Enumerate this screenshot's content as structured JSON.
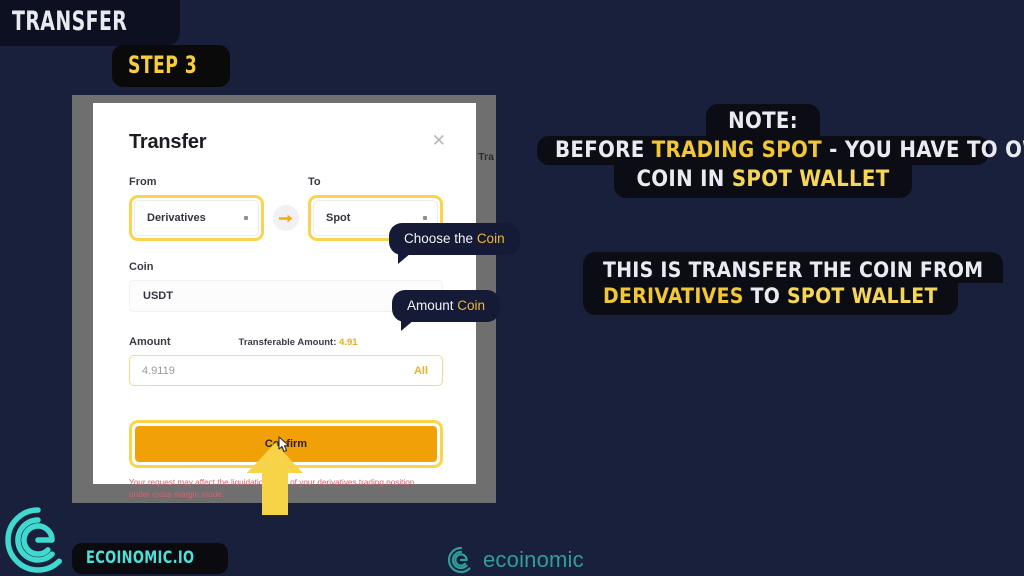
{
  "badges": {
    "transfer": "TRANSFER",
    "step": "STEP 3"
  },
  "app_window": {
    "background_tab_label": "Tra"
  },
  "modal": {
    "title": "Transfer",
    "close_icon": "close-icon",
    "from_label": "From",
    "from_value": "Derivatives",
    "to_label": "To",
    "to_value": "Spot",
    "swap_icon": "arrow-right-icon",
    "coin_label": "Coin",
    "coin_value": "USDT",
    "amount_label": "Amount",
    "transferable_prefix": "Transferable Amount: ",
    "transferable_value": "4.91",
    "amount_value": "4.9119",
    "all_label": "All",
    "confirm_label": "Confirm",
    "warning": "Your request may affect the liquidation price of your derivatives trading position under cross margin mode."
  },
  "tooltips": {
    "coin": {
      "text": "Choose the ",
      "highlight": "Coin"
    },
    "amount": {
      "text": "Amount ",
      "highlight": "Coin"
    }
  },
  "notes": {
    "note1": {
      "line1": "NOTE:",
      "line2_a": "BEFORE ",
      "line2_hl": "TRADING SPOT",
      "line2_b": " - YOU HAVE TO OWN",
      "line3_a": "COIN IN ",
      "line3_hl": "SPOT WALLET"
    },
    "note2": {
      "line1": "THIS IS TRANSFER THE COIN FROM",
      "line2_hl1": "DERIVATIVES",
      "line2_mid": " TO ",
      "line2_hl2": "SPOT WALLET"
    }
  },
  "branding": {
    "pill": "ECOINOMIC.IO",
    "watermark": "ecoinomic",
    "logo_icon": "ecoinomic-logo-icon"
  },
  "colors": {
    "background": "#19203c",
    "accent_yellow": "#fbd34d",
    "accent_orange": "#f2a007",
    "note_highlight": "#f2c734",
    "brand_teal": "#4fe0d8",
    "warning_red": "#d9616e"
  }
}
